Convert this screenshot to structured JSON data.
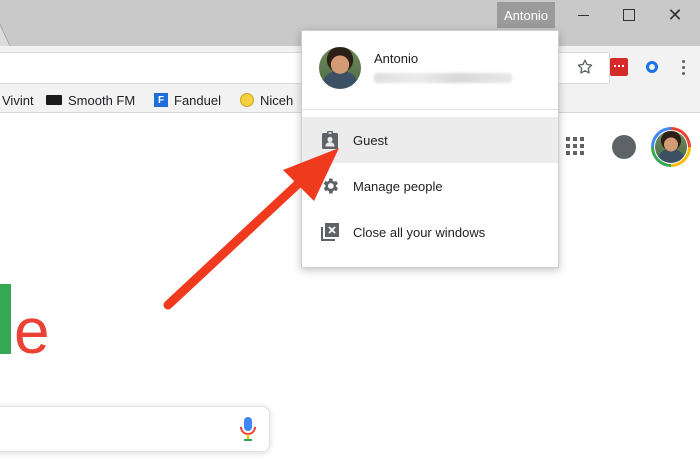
{
  "window": {
    "profile_name": "Antonio"
  },
  "bookmarks": [
    {
      "label": "Vivint"
    },
    {
      "label": "Smooth FM"
    },
    {
      "label": "Fanduel"
    },
    {
      "label": "Niceh"
    }
  ],
  "profile_menu": {
    "user_name": "Antonio",
    "user_email": "",
    "items": [
      {
        "label": "Guest",
        "icon": "guest-badge-icon",
        "highlighted": true
      },
      {
        "label": "Manage people",
        "icon": "gear-icon",
        "highlighted": false
      },
      {
        "label": "Close all your windows",
        "icon": "close-windows-icon",
        "highlighted": false
      }
    ]
  },
  "page": {
    "logo_fragment": "le"
  },
  "colors": {
    "arrow": "#f03a1e",
    "titlebar": "#c9c9c9",
    "toolbar": "#f2f2f2",
    "menu_hover": "#ececec",
    "logo_green": "#34a853",
    "logo_red": "#ea4335"
  }
}
